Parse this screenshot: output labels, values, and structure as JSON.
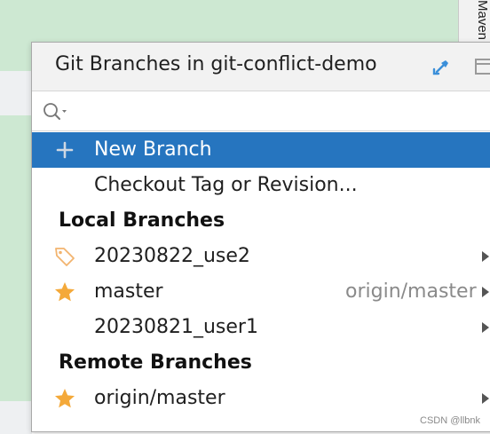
{
  "background": {
    "side_tab_label": "Maven"
  },
  "popup": {
    "title": "Git Branches in git-conflict-demo",
    "search": {
      "value": "",
      "placeholder": ""
    },
    "actions": [
      {
        "label": "New Branch",
        "icon": "plus-icon",
        "selected": true
      },
      {
        "label": "Checkout Tag or Revision..."
      }
    ],
    "local_header": "Local Branches",
    "local_branches": [
      {
        "name": "20230822_use2",
        "icon": "tag-icon",
        "tracking": ""
      },
      {
        "name": "master",
        "icon": "star-icon",
        "tracking": "origin/master"
      },
      {
        "name": "20230821_user1",
        "icon": "",
        "tracking": ""
      }
    ],
    "remote_header": "Remote Branches",
    "remote_branches": [
      {
        "name": "origin/master",
        "icon": "star-icon"
      }
    ]
  },
  "watermark": "CSDN @llbnk",
  "colors": {
    "selection": "#2675bf",
    "star": "#f4a93a",
    "tag": "#f2b46f",
    "editor_bg": "#cde8d2"
  }
}
